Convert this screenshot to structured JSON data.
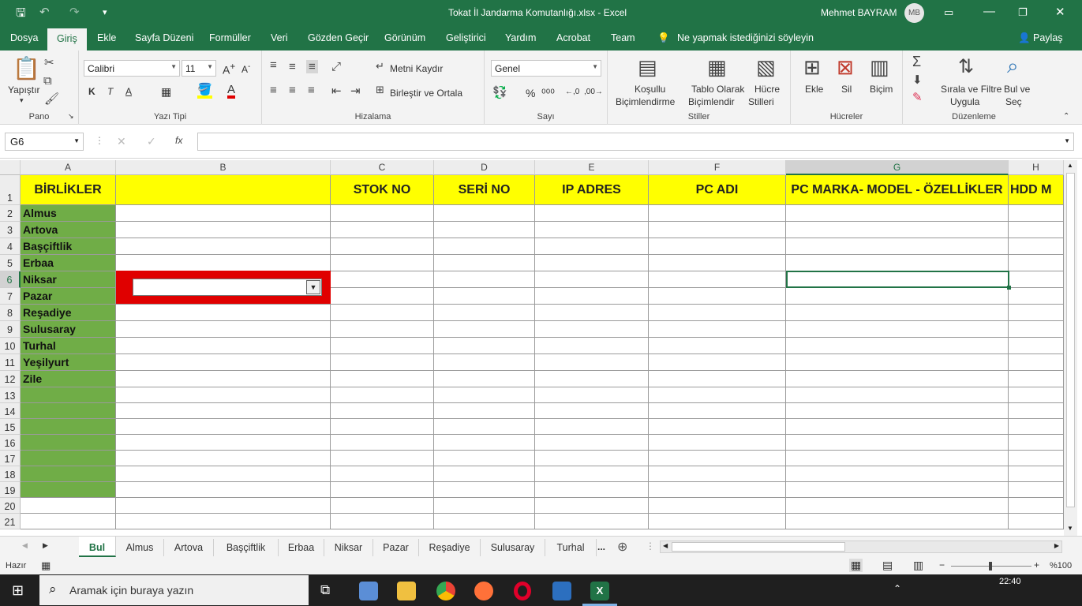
{
  "titlebar": {
    "title": "Tokat İl Jandarma Komutanlığı.xlsx  -  Excel",
    "user": "Mehmet BAYRAM",
    "initials": "MB"
  },
  "menu": [
    "Dosya",
    "Giriş",
    "Ekle",
    "Sayfa Düzeni",
    "Formüller",
    "Veri",
    "Gözden Geçir",
    "Görünüm",
    "Geliştirici",
    "Yardım",
    "Acrobat",
    "Team"
  ],
  "tell_me": "Ne yapmak istediğinizi söyleyin",
  "share": "Paylaş",
  "ribbon": {
    "clipboard": {
      "paste": "Yapıştır",
      "label": "Pano"
    },
    "font": {
      "name": "Calibri",
      "size": "11",
      "label": "Yazı Tipi",
      "bold": "K",
      "italic": "T",
      "underline": "A"
    },
    "alignment": {
      "wrap": "Metni Kaydır",
      "merge": "Birleştir ve Ortala",
      "label": "Hizalama"
    },
    "number": {
      "format": "Genel",
      "label": "Sayı"
    },
    "styles": {
      "conditional": [
        "Koşullu",
        "Biçimlendirme"
      ],
      "table": [
        "Tablo Olarak",
        "Biçimlendir"
      ],
      "cell": [
        "Hücre",
        "Stilleri"
      ],
      "label": "Stiller"
    },
    "cells": {
      "insert": "Ekle",
      "delete": "Sil",
      "format": "Biçim",
      "label": "Hücreler"
    },
    "editing": {
      "sort": [
        "Sırala ve Filtre",
        "Uygula"
      ],
      "find": [
        "Bul ve",
        "Seç"
      ],
      "label": "Düzenleme"
    }
  },
  "formula": {
    "namebox": "G6",
    "fx": "fx"
  },
  "columns": [
    {
      "name": "A",
      "header": "BİRLİKLER"
    },
    {
      "name": "B",
      "header": ""
    },
    {
      "name": "C",
      "header": "STOK NO"
    },
    {
      "name": "D",
      "header": "SERİ NO"
    },
    {
      "name": "E",
      "header": "IP ADRES"
    },
    {
      "name": "F",
      "header": "PC ADI"
    },
    {
      "name": "G",
      "header": "PC MARKA- MODEL - ÖZELLİKLER"
    },
    {
      "name": "H",
      "header": "HDD M"
    }
  ],
  "row_numbers": [
    "1",
    "2",
    "3",
    "4",
    "5",
    "6",
    "7",
    "8",
    "9",
    "10",
    "11",
    "12",
    "13",
    "14",
    "15",
    "16",
    "17",
    "18",
    "19",
    "20",
    "21"
  ],
  "units": [
    "Almus",
    "Artova",
    "Başçiftlik",
    "Erbaa",
    "Niksar",
    "Pazar",
    "Reşadiye",
    "Sulusaray",
    "Turhal",
    "Yeşilyurt",
    "Zile"
  ],
  "green_rows_total": 18,
  "sheet_tabs": [
    "Bul",
    "Almus",
    "Artova",
    "Başçiftlik",
    "Erbaa",
    "Niksar",
    "Pazar",
    "Reşadiye",
    "Sulusaray",
    "Turhal"
  ],
  "sheet_more": "...",
  "status": {
    "ready": "Hazır",
    "zoom": "%100"
  },
  "taskbar": {
    "search": "Aramak için buraya yazın",
    "time": "22:40"
  },
  "colors": {
    "excel_green": "#217346",
    "header_yellow": "#ffff00",
    "unit_green": "#70ad47",
    "selection_red": "#e00000"
  }
}
